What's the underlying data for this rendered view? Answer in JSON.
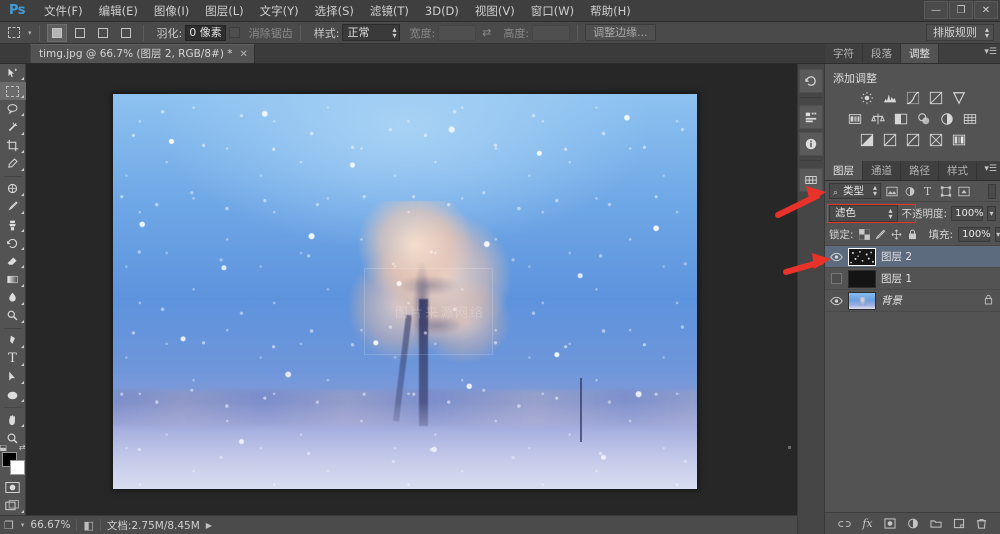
{
  "app": {
    "logo": "Ps"
  },
  "menubar": {
    "items": [
      {
        "label": "文件(F)"
      },
      {
        "label": "编辑(E)"
      },
      {
        "label": "图像(I)"
      },
      {
        "label": "图层(L)"
      },
      {
        "label": "文字(Y)"
      },
      {
        "label": "选择(S)"
      },
      {
        "label": "滤镜(T)"
      },
      {
        "label": "3D(D)"
      },
      {
        "label": "视图(V)"
      },
      {
        "label": "窗口(W)"
      },
      {
        "label": "帮助(H)"
      }
    ],
    "window_controls": {
      "minimize": "—",
      "restore": "❐",
      "close": "✕"
    }
  },
  "options_bar": {
    "feather_label": "羽化:",
    "feather_value": "0 像素",
    "antialias_label": "消除锯齿",
    "style_label": "样式:",
    "style_value": "正常",
    "width_label": "宽度:",
    "width_value": "",
    "height_label": "高度:",
    "height_value": "",
    "swap_icon": "⇄",
    "refine_edge_label": "调整边缘...",
    "workspace_label": "排版规则"
  },
  "document_tab": {
    "title": "timg.jpg @ 66.7% (图层 2, RGB/8#) *",
    "close": "✕"
  },
  "toolbox": {
    "tools": [
      {
        "name": "move-tool",
        "glyph": "➤"
      },
      {
        "name": "rectangular-marquee-tool",
        "glyph": "▭",
        "active": true
      },
      {
        "name": "lasso-tool",
        "glyph": "𝒫"
      },
      {
        "name": "magic-wand-tool",
        "glyph": "✦"
      },
      {
        "name": "crop-tool",
        "glyph": "⌗"
      },
      {
        "name": "eyedropper-tool",
        "glyph": "⌁"
      },
      {
        "name": "spot-healing-brush-tool",
        "glyph": "✺"
      },
      {
        "name": "brush-tool",
        "glyph": "✎"
      },
      {
        "name": "clone-stamp-tool",
        "glyph": "⛭"
      },
      {
        "name": "history-brush-tool",
        "glyph": "↻"
      },
      {
        "name": "eraser-tool",
        "glyph": "◖"
      },
      {
        "name": "gradient-tool",
        "glyph": "◨"
      },
      {
        "name": "blur-tool",
        "glyph": "💧"
      },
      {
        "name": "dodge-tool",
        "glyph": "◌"
      },
      {
        "name": "pen-tool",
        "glyph": "✒"
      },
      {
        "name": "horizontal-type-tool",
        "glyph": "T"
      },
      {
        "name": "path-selection-tool",
        "glyph": "↖"
      },
      {
        "name": "ellipse-tool",
        "glyph": "⬭"
      },
      {
        "name": "hand-tool",
        "glyph": "✋"
      },
      {
        "name": "zoom-tool",
        "glyph": "🔍"
      }
    ],
    "default_colors_icon": "default-colors-icon",
    "swap_colors_icon": "swap-colors-icon",
    "foreground_color": "#000000",
    "background_color": "#ffffff",
    "quick_mask_icon": "quick-mask-icon",
    "screen_mode_icon": "screen-mode-icon"
  },
  "canvas": {
    "watermark": "图片来源网络",
    "zoom": "66.7%"
  },
  "status_bar": {
    "zoom": "66.67%",
    "doc_label": "文档:2.75M/8.45M",
    "arrow": "▶"
  },
  "dock_strip": {
    "items": [
      {
        "name": "history-panel-icon",
        "glyph": "↺"
      },
      {
        "name": "actions-panel-icon",
        "glyph": "▤"
      },
      {
        "name": "info-panel-icon",
        "glyph": "i"
      },
      {
        "name": "swatches-panel-icon",
        "glyph": "▦"
      }
    ]
  },
  "panels": {
    "top_group": {
      "tabs": [
        {
          "label": "字符",
          "active": false
        },
        {
          "label": "段落",
          "active": false
        },
        {
          "label": "调整",
          "active": true
        }
      ],
      "menu_icon": "panel-menu-icon",
      "adjustments": {
        "title": "添加调整",
        "row1": [
          {
            "name": "brightness-contrast-adjustment",
            "glyph": "☀"
          },
          {
            "name": "levels-adjustment",
            "glyph": "▄"
          },
          {
            "name": "curves-adjustment",
            "glyph": "∿"
          },
          {
            "name": "exposure-adjustment",
            "glyph": "◩"
          },
          {
            "name": "vibrance-adjustment",
            "glyph": "▽"
          }
        ],
        "row2": [
          {
            "name": "hue-saturation-adjustment",
            "glyph": "▥"
          },
          {
            "name": "color-balance-adjustment",
            "glyph": "⚖"
          },
          {
            "name": "black-white-adjustment",
            "glyph": "◧"
          },
          {
            "name": "photo-filter-adjustment",
            "glyph": "◉"
          },
          {
            "name": "channel-mixer-adjustment",
            "glyph": "◕"
          },
          {
            "name": "color-lookup-adjustment",
            "glyph": "▦"
          }
        ],
        "row3": [
          {
            "name": "invert-adjustment",
            "glyph": "◪"
          },
          {
            "name": "posterize-adjustment",
            "glyph": "◺"
          },
          {
            "name": "threshold-adjustment",
            "glyph": "◿"
          },
          {
            "name": "gradient-map-adjustment",
            "glyph": "⧄"
          },
          {
            "name": "selective-color-adjustment",
            "glyph": "▉"
          }
        ]
      }
    },
    "layers_group": {
      "tabs": [
        {
          "label": "图层",
          "active": true
        },
        {
          "label": "通道",
          "active": false
        },
        {
          "label": "路径",
          "active": false
        },
        {
          "label": "样式",
          "active": false
        }
      ],
      "menu_icon": "panel-menu-icon",
      "filter": {
        "kind_label": "类型",
        "search_icon": "search-icon",
        "type_filters": [
          {
            "name": "filter-pixel-layers-icon",
            "glyph": "▣"
          },
          {
            "name": "filter-adjustment-layers-icon",
            "glyph": "◐"
          },
          {
            "name": "filter-type-layers-icon",
            "glyph": "T"
          },
          {
            "name": "filter-shape-layers-icon",
            "glyph": "▢"
          },
          {
            "name": "filter-smart-objects-icon",
            "glyph": "⬚"
          }
        ],
        "toggle_name": "filter-toggle-switch"
      },
      "blend_mode": "滤色",
      "opacity_label": "不透明度:",
      "opacity_value": "100%",
      "lock_label": "锁定:",
      "lock_icons": [
        {
          "name": "lock-transparent-pixels-icon",
          "glyph": "▨"
        },
        {
          "name": "lock-image-pixels-icon",
          "glyph": "✎"
        },
        {
          "name": "lock-position-icon",
          "glyph": "✥"
        },
        {
          "name": "lock-all-icon",
          "glyph": "🔒"
        }
      ],
      "fill_label": "填充:",
      "fill_value": "100%",
      "layers": [
        {
          "name": "图层 2",
          "visible": true,
          "selected": true,
          "thumb": "noise",
          "locked": false
        },
        {
          "name": "图层 1",
          "visible": false,
          "selected": false,
          "thumb": "black",
          "locked": false
        },
        {
          "name": "背景",
          "visible": true,
          "selected": false,
          "thumb": "photo",
          "locked": true
        }
      ],
      "footer_icons": [
        {
          "name": "link-layers-icon",
          "glyph": "🔗"
        },
        {
          "name": "layer-style-fx-icon",
          "glyph": "fx"
        },
        {
          "name": "add-layer-mask-icon",
          "glyph": "▣"
        },
        {
          "name": "new-adjustment-layer-icon",
          "glyph": "◑"
        },
        {
          "name": "new-group-icon",
          "glyph": "▤"
        },
        {
          "name": "new-layer-icon",
          "glyph": "⊞"
        },
        {
          "name": "delete-layer-icon",
          "glyph": "🗑"
        }
      ]
    }
  },
  "annotations": {
    "blend_mode_highlight_color": "#e8322a",
    "arrows": [
      {
        "name": "arrow-to-blend-mode"
      },
      {
        "name": "arrow-to-layer-visibility"
      }
    ]
  }
}
